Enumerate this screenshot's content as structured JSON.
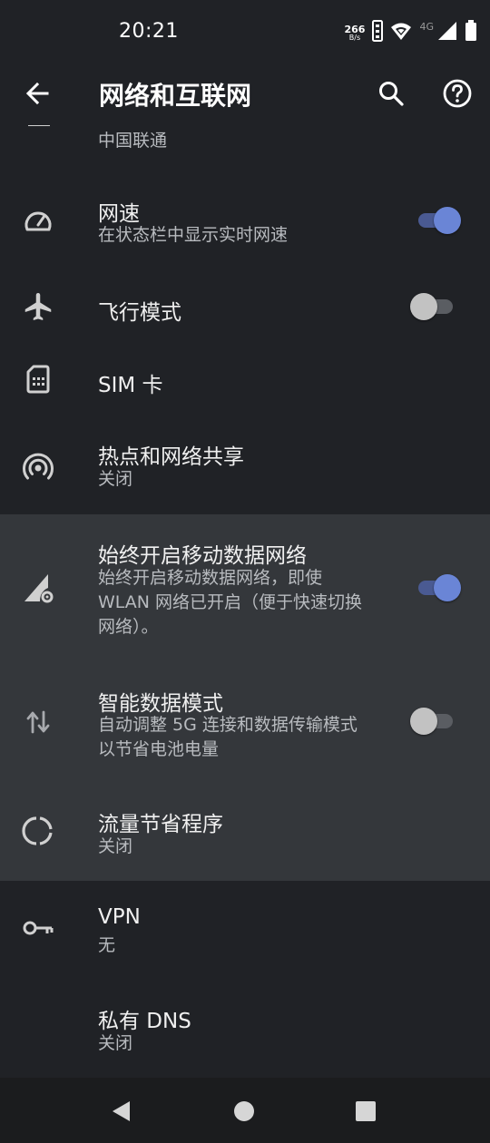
{
  "status_bar": {
    "time": "20:21",
    "net_speed_value": "266",
    "net_speed_unit": "B/s",
    "network_type": "4G"
  },
  "toolbar": {
    "title": "网络和互联网"
  },
  "settings": {
    "carrier": {
      "text": "中国联通"
    },
    "net_speed": {
      "title": "网速",
      "subtitle": "在状态栏中显示实时网速",
      "enabled": true
    },
    "airplane_mode": {
      "title": "飞行模式",
      "enabled": false
    },
    "sim_card": {
      "title": "SIM 卡"
    },
    "hotspot": {
      "title": "热点和网络共享",
      "subtitle": "关闭"
    },
    "mobile_data_always_on": {
      "title": "始终开启移动数据网络",
      "subtitle": "始终开启移动数据网络，即使 WLAN 网络已开启（便于快速切换网络）。",
      "enabled": true
    },
    "smart_data_mode": {
      "title": "智能数据模式",
      "subtitle": "自动调整 5G 连接和数据传输模式以节省电池电量",
      "enabled": false
    },
    "data_saver": {
      "title": "流量节省程序",
      "subtitle": "关闭"
    },
    "vpn": {
      "title": "VPN",
      "subtitle": "无"
    },
    "private_dns": {
      "title": "私有 DNS",
      "subtitle": "关闭"
    }
  },
  "colors": {
    "background": "#202226",
    "highlight": "#34373b",
    "toggle_on": "#6a85d6",
    "toggle_off": "#c2c2c2"
  }
}
